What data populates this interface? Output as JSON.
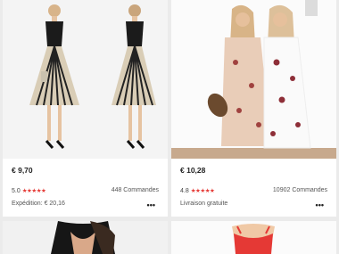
{
  "products": [
    {
      "price": "€ 9,70",
      "rating": "5.0",
      "stars": "★★★★★",
      "orders": "448 Commandes",
      "shipping": "Expédition: € 20,16",
      "more": "•••",
      "image": "black-and-tan-pleated-midi-dress"
    },
    {
      "price": "€ 10,28",
      "rating": "4.8",
      "stars": "★★★★★",
      "orders": "10902 Commandes",
      "shipping": "Livraison gratuite",
      "more": "•••",
      "image": "floral-off-shoulder-maxi-dresses"
    },
    {
      "image": "black-lace-top"
    },
    {
      "image": "red-sleeveless-top"
    }
  ],
  "colors": {
    "star": "#e53935",
    "background": "#ebebeb",
    "card": "#ffffff"
  }
}
